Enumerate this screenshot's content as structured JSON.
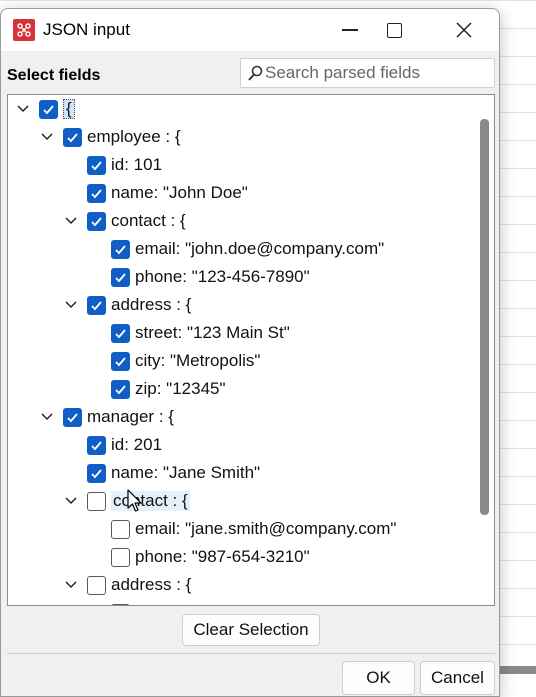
{
  "window": {
    "title": "JSON input",
    "icon": "app-logo-icon",
    "accent": "#d5323a"
  },
  "section_label": "Select fields",
  "search": {
    "placeholder": "Search parsed fields",
    "value": ""
  },
  "tree": {
    "rows": [
      {
        "label": "{",
        "checked": true,
        "expanded": true,
        "level": 0,
        "root": true
      },
      {
        "label": "employee : {",
        "checked": true,
        "expanded": true,
        "level": 1
      },
      {
        "label": "id: 101",
        "checked": true,
        "level": 2
      },
      {
        "label": "name: \"John Doe\"",
        "checked": true,
        "level": 2
      },
      {
        "label": "contact : {",
        "checked": true,
        "expanded": true,
        "level": 2
      },
      {
        "label": "email: \"john.doe@company.com\"",
        "checked": true,
        "level": 3
      },
      {
        "label": "phone: \"123-456-7890\"",
        "checked": true,
        "level": 3
      },
      {
        "label": "address : {",
        "checked": true,
        "expanded": true,
        "level": 2
      },
      {
        "label": "street: \"123 Main St\"",
        "checked": true,
        "level": 3
      },
      {
        "label": "city: \"Metropolis\"",
        "checked": true,
        "level": 3
      },
      {
        "label": "zip: \"12345\"",
        "checked": true,
        "level": 3
      },
      {
        "label": "manager : {",
        "checked": true,
        "expanded": true,
        "level": 1
      },
      {
        "label": "id: 201",
        "checked": true,
        "level": 2
      },
      {
        "label": "name: \"Jane Smith\"",
        "checked": true,
        "level": 2
      },
      {
        "label": "contact : {",
        "checked": false,
        "expanded": true,
        "level": 2,
        "hover": true
      },
      {
        "label": "email: \"jane.smith@company.com\"",
        "checked": false,
        "level": 3
      },
      {
        "label": "phone: \"987-654-3210\"",
        "checked": false,
        "level": 3
      },
      {
        "label": "address : {",
        "checked": false,
        "expanded": true,
        "level": 2
      },
      {
        "label": "",
        "checked": false,
        "level": 3
      }
    ]
  },
  "buttons": {
    "clear_selection": "Clear Selection",
    "ok": "OK",
    "cancel": "Cancel"
  },
  "colors": {
    "checkbox_checked": "#0f5fc6"
  }
}
